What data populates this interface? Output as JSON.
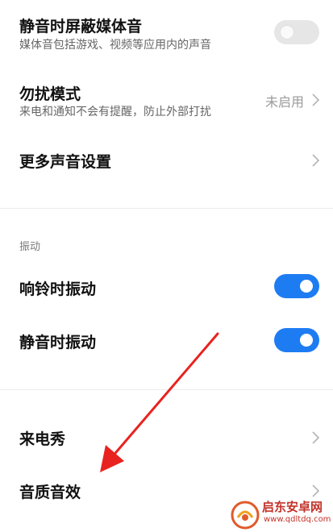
{
  "items": {
    "mute_media": {
      "title": "静音时屏蔽媒体音",
      "subtitle": "媒体音包括游戏、视频等应用内的声音",
      "enabled": false
    },
    "dnd": {
      "title": "勿扰模式",
      "subtitle": "来电和通知不会有提醒，防止外部打扰",
      "value": "未启用"
    },
    "more_sound": {
      "title": "更多声音设置"
    },
    "vibrate_section": {
      "label": "振动"
    },
    "vibrate_ring": {
      "title": "响铃时振动",
      "enabled": true
    },
    "vibrate_silent": {
      "title": "静音时振动",
      "enabled": true
    },
    "caller_show": {
      "title": "来电秀"
    },
    "sound_quality": {
      "title": "音质音效"
    }
  },
  "watermark": {
    "name": "启东安卓网",
    "url": "www.qdltdq.com"
  },
  "colors": {
    "accent": "#1e7cf2",
    "arrow": "#e8231f",
    "watermark": "#c3332a"
  }
}
